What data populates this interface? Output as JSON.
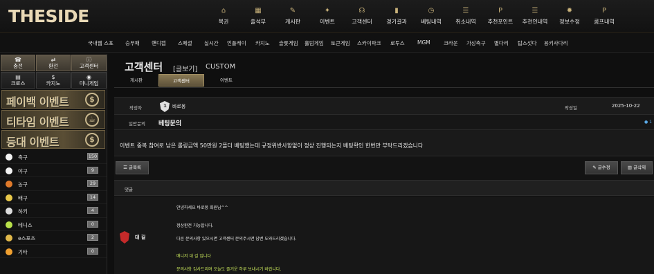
{
  "logo": "THESIDE",
  "topnav": [
    {
      "icon": "building-icon",
      "glyph": "⌂",
      "label": "복귄"
    },
    {
      "icon": "calendar-icon",
      "glyph": "▦",
      "label": "출석부"
    },
    {
      "icon": "board-icon",
      "glyph": "✎",
      "label": "게시판"
    },
    {
      "icon": "sparkle-icon",
      "glyph": "✦",
      "label": "이벤트"
    },
    {
      "icon": "headset-icon",
      "glyph": "☊",
      "label": "고객센터"
    },
    {
      "icon": "bar-chart-icon",
      "glyph": "▮",
      "label": "경기결과"
    },
    {
      "icon": "clock-icon",
      "glyph": "◷",
      "label": "베팅내역"
    },
    {
      "icon": "list-icon",
      "glyph": "☰",
      "label": "취소내역"
    },
    {
      "icon": "coin-icon",
      "glyph": "P",
      "label": "추천포인트"
    },
    {
      "icon": "list-icon",
      "glyph": "☰",
      "label": "추천인내역"
    },
    {
      "icon": "gear-icon",
      "glyph": "✹",
      "label": "정보수정"
    },
    {
      "icon": "coin-icon",
      "glyph": "P",
      "label": "콤프내역"
    }
  ],
  "subnav": [
    "국내웹 스포",
    "승무패",
    "핸디캡",
    "스페셜",
    "실시간",
    "인플레이",
    "카지노",
    "슬롯게임",
    "홀덤게임",
    "토큰게임",
    "스카이파크",
    "로투스",
    "MGM",
    "크라운",
    "가상축구",
    "별다리",
    "탑스섯다",
    "용키사다리"
  ],
  "sidebar": {
    "quick": [
      {
        "icon": "phone-icon",
        "glyph": "☎",
        "label": "충전",
        "dark": false
      },
      {
        "icon": "exchange-icon",
        "glyph": "⇄",
        "label": "환전",
        "dark": false
      },
      {
        "icon": "info-icon",
        "glyph": "ⓘ",
        "label": "고객센터",
        "dark": false
      },
      {
        "icon": "cards-icon",
        "glyph": "▤",
        "label": "크로스",
        "dark": true
      },
      {
        "icon": "dollar-icon",
        "glyph": "$",
        "label": "카지노",
        "dark": true
      },
      {
        "icon": "gamepad-icon",
        "glyph": "◉",
        "label": "미니게임",
        "dark": true
      }
    ],
    "banners": [
      {
        "text": "페이백 이벤트",
        "icon": "dollar-coin-icon",
        "glyph": "$"
      },
      {
        "text": "티타임 이벤트",
        "icon": "coffee-icon",
        "glyph": "☕"
      },
      {
        "text": "등대 이벤트",
        "icon": "dollar-coin-icon",
        "glyph": "$"
      }
    ],
    "sports": [
      {
        "icon": "soccer-icon",
        "color": "#f2f2f2",
        "label": "축구",
        "count": "150"
      },
      {
        "icon": "baseball-icon",
        "color": "#f2f2f2",
        "label": "야구",
        "count": "9"
      },
      {
        "icon": "basketball-icon",
        "color": "#e07a2a",
        "label": "농구",
        "count": "29"
      },
      {
        "icon": "volleyball-icon",
        "color": "#e8c84a",
        "label": "배구",
        "count": "14"
      },
      {
        "icon": "hockey-icon",
        "color": "#dddddd",
        "label": "하키",
        "count": "4"
      },
      {
        "icon": "tennis-icon",
        "color": "#b8e04a",
        "label": "테니스",
        "count": "0"
      },
      {
        "icon": "esports-icon",
        "color": "#e0b84a",
        "label": "e스포츠",
        "count": "2"
      },
      {
        "icon": "etc-icon",
        "color": "#f0a030",
        "label": "기타",
        "count": "0"
      }
    ]
  },
  "main": {
    "title": "고객센터",
    "mode": "[글보기]",
    "english": "CUSTOM",
    "tabs": [
      "게시판",
      "고객센터",
      "이벤트"
    ],
    "active_tab": 1,
    "author_label": "작성자",
    "author": "바로몽",
    "date_label": "작성일",
    "date": "2025-10-22",
    "category": "일반문의",
    "subject": "베팅문의",
    "comment_count": "1",
    "content": "이벤트 중복 참여로 남은 롤링금액 50만원 2폴더 베팅했는데 규정위반사항없이 정상 진행되는지 베팅확인 한번만 부탁드리겠습니다",
    "list_button": "글목록",
    "edit_button": "글수정",
    "delete_button": "글삭제",
    "comment_header": "댓글",
    "reply_name": "대 길",
    "reply_lines": [
      {
        "text": "안녕하세요 바로몽 회원님^^",
        "green": false
      },
      {
        "text": "정상환전 가능합니다.",
        "green": false
      },
      {
        "text": "다른 문의사항 있으시면 고객센터 문의주시면 답변 도와드리겠습니다.",
        "green": false
      },
      {
        "text": "매니저 대 길 입니다",
        "green": true
      },
      {
        "text": "문의사항 감사드리며 오늘도 즐거운 하루 보내시기 바랍니다.",
        "green": true
      }
    ]
  }
}
